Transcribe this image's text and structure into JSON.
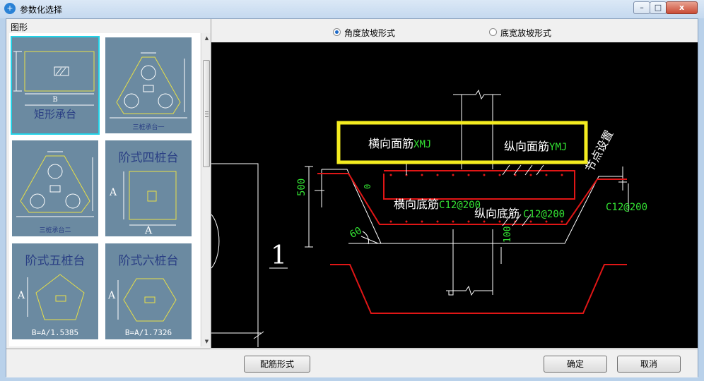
{
  "window": {
    "title": "参数化选择",
    "app_icon": "+"
  },
  "window_controls": {
    "minimize": "–",
    "maximize": "□",
    "close": "x"
  },
  "shape_panel": {
    "label": "图形",
    "thumbnails": [
      {
        "caption": "矩形承台",
        "dim_label": "B"
      },
      {
        "caption": "三桩承台一"
      },
      {
        "caption": "三桩承台二"
      },
      {
        "caption": "阶式四桩台",
        "dim_a": "A",
        "dim_b": "A"
      },
      {
        "caption": "阶式五桩台",
        "dim_a": "A",
        "dim_b": "B=A/1.5385"
      },
      {
        "caption": "阶式六桩台",
        "dim_a": "A",
        "dim_b": "B=A/1.7326"
      }
    ]
  },
  "slope_options": [
    {
      "label": "角度放坡形式",
      "selected": true
    },
    {
      "label": "底宽放坡形式",
      "selected": false
    }
  ],
  "drawing": {
    "top_bar_label": "横向面筋",
    "top_bar_code": "XMJ",
    "long_top_label": "纵向面筋",
    "long_top_code": "YMJ",
    "node_setting": "节点设置",
    "bottom_bar_label": "横向底筋",
    "bottom_bar_code": "C12@200",
    "long_bottom_label": "纵向底筋",
    "long_bottom_code": "C12@200",
    "side_code": "C12@200",
    "height_dim": "500",
    "cover_dim": "0",
    "angle_dim": "60",
    "base_dim": "100",
    "scale_mark": "1"
  },
  "buttons": {
    "rebar_form": "配筋形式",
    "ok": "确定",
    "cancel": "取消"
  }
}
